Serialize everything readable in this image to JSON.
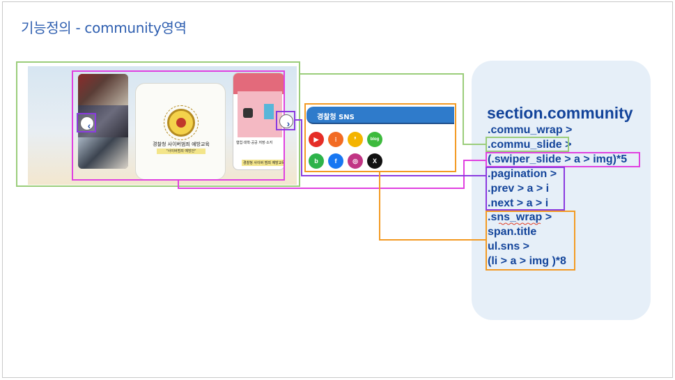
{
  "page": {
    "title": "기능정의 - community영역"
  },
  "mockup": {
    "center_card": {
      "caption": "경찰청 사이버범죄 예방교육",
      "tag": "\"사이버범죄 예방안\""
    },
    "right_card": {
      "label_top": "협업·대학·공공   저장·소지",
      "label_bottom": "경찰청 사이버 범죄 예방교육"
    },
    "prev_icon": "chevron-left-icon",
    "next_icon": "chevron-right-icon",
    "prev_glyph": "‹",
    "next_glyph": "›"
  },
  "sns": {
    "title": "경찰청 SNS",
    "icons": [
      {
        "name": "youtube",
        "glyph": "▶",
        "color": "#e52d27"
      },
      {
        "name": "dots-app",
        "glyph": "⁝",
        "color": "#f26b23"
      },
      {
        "name": "kakaostory",
        "glyph": "❜",
        "color": "#f4b400"
      },
      {
        "name": "blog",
        "glyph": "blog",
        "color": "#3dba3d"
      },
      {
        "name": "band",
        "glyph": "b",
        "color": "#2db34a"
      },
      {
        "name": "facebook",
        "glyph": "f",
        "color": "#1877f2"
      },
      {
        "name": "instagram",
        "glyph": "◎",
        "color": "#c13584"
      },
      {
        "name": "x",
        "glyph": "X",
        "color": "#111111"
      }
    ]
  },
  "panel": {
    "section": "section.community",
    "lines": [
      ".commu_wrap >",
      ".commu_slide >",
      "(.swiper_slide > a > img)*5",
      ".pagination >",
      ".prev > a > i",
      ".next > a > i",
      ".sns_wrap >",
      "span.title",
      "ul.sns >",
      "(li > a > img )*8"
    ]
  },
  "colors": {
    "green": "#9acd7a",
    "magenta": "#e040e0",
    "purple": "#8a3adf",
    "orange": "#f39a22",
    "code_blue": "#13449a",
    "title_blue": "#2f5fb0"
  }
}
